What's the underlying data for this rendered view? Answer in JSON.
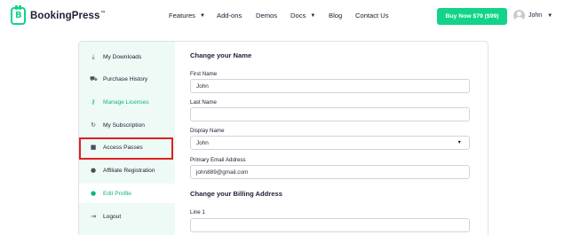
{
  "header": {
    "logo_text": "BookingPress",
    "logo_tm": "™",
    "nav": {
      "features": "Features",
      "addons": "Add-ons",
      "demos": "Demos",
      "docs": "Docs",
      "blog": "Blog",
      "contact": "Contact Us"
    },
    "buy_button": "Buy Now $79 ($99)",
    "user_name": "John"
  },
  "sidebar": {
    "items": [
      {
        "label": "My Downloads",
        "icon": "download-icon"
      },
      {
        "label": "Purchase History",
        "icon": "cart-icon"
      },
      {
        "label": "Manage Licenses",
        "icon": "key-icon"
      },
      {
        "label": "My Subscription",
        "icon": "refresh-icon"
      },
      {
        "label": "Access Passes",
        "icon": "lock-icon"
      },
      {
        "label": "Affiliate Registration",
        "icon": "info-icon"
      },
      {
        "label": "Edit Profile",
        "icon": "user-icon"
      },
      {
        "label": "Logout",
        "icon": "logout-icon"
      }
    ]
  },
  "form": {
    "name_section_title": "Change your Name",
    "first_name_label": "First Name",
    "first_name_value": "John",
    "last_name_label": "Last Name",
    "last_name_value": "",
    "display_name_label": "Display Name",
    "display_name_value": "John",
    "email_label": "Primary Email Address",
    "email_value": "john889@gmail.com",
    "billing_section_title": "Change your Billing Address",
    "line1_label": "Line 1",
    "line1_value": ""
  },
  "colors": {
    "brand_green": "#12d488",
    "highlight_red": "#e02020",
    "sidebar_bg": "#eefaf5"
  }
}
